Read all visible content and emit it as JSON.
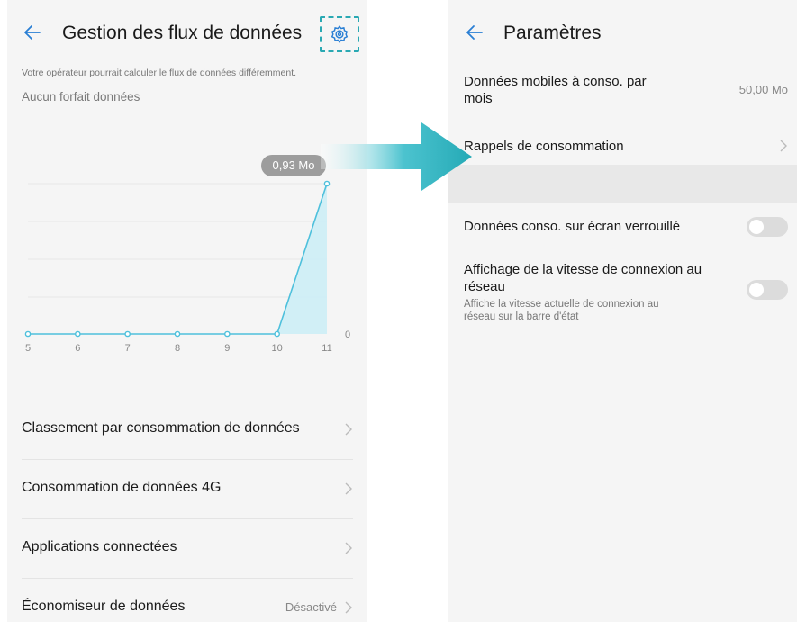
{
  "left_screen": {
    "title": "Gestion des flux de données",
    "note": "Votre opérateur pourrait calculer le flux de données différemment.",
    "plan": "Aucun forfait données",
    "icons": {
      "back": "back-arrow-icon",
      "settings": "gear-icon"
    },
    "menu": [
      {
        "label": "Classement par consommation de données",
        "value": ""
      },
      {
        "label": "Consommation de données 4G",
        "value": ""
      },
      {
        "label": "Applications connectées",
        "value": ""
      },
      {
        "label": "Économiseur de données",
        "value": "Désactivé"
      }
    ]
  },
  "right_screen": {
    "title": "Paramètres",
    "items": {
      "monthly_data": {
        "label_line1": "Données mobiles à conso. par",
        "label_line2": "mois",
        "value": "50,00 Mo"
      },
      "reminders": {
        "label": "Rappels de consommation"
      },
      "lockscreen": {
        "label": "Données conso. sur écran verrouillé",
        "enabled": false
      },
      "speed": {
        "label_line1": "Affichage de la vitesse de connexion au",
        "label_line2": "réseau",
        "desc_line1": "Affiche la vitesse actuelle de connexion au",
        "desc_line2": "réseau sur la barre d'état",
        "enabled": false
      }
    }
  },
  "colors": {
    "accent": "#2aa9b3",
    "chart_line": "#4ec0dc",
    "chart_fill": "#cdeef6"
  },
  "chart_data": {
    "type": "area",
    "x": [
      5,
      6,
      7,
      8,
      9,
      10,
      11
    ],
    "x_labels": [
      "5",
      "6",
      "7",
      "8",
      "9",
      "10",
      "11"
    ],
    "values": [
      0,
      0,
      0,
      0,
      0,
      0,
      0.93
    ],
    "unit": "Mo",
    "y_label": "0",
    "tooltip": "0,93 Mo"
  }
}
